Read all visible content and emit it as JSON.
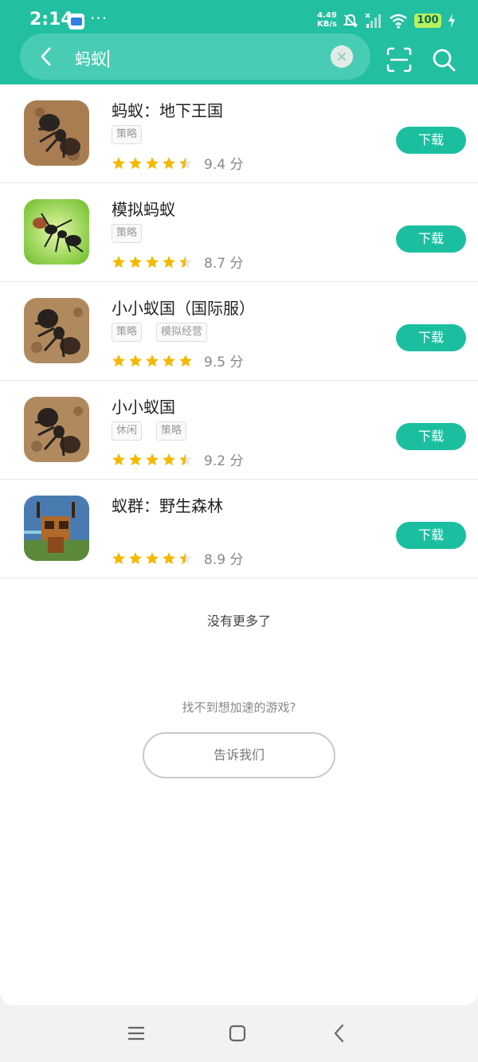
{
  "status_bar": {
    "time": "2:14",
    "more": "···",
    "net_speed_value": "4.49",
    "net_speed_unit": "KB/s",
    "battery": "100"
  },
  "search": {
    "query": "蚂蚁"
  },
  "games": [
    {
      "title": "蚂蚁：地下王国",
      "tags": [
        "策略"
      ],
      "rating": 4.5,
      "score": "9.4 分",
      "download_label": "下载",
      "icon": "ant-underground-kingdom-icon"
    },
    {
      "title": "模拟蚂蚁",
      "tags": [
        "策略"
      ],
      "rating": 4.5,
      "score": "8.7 分",
      "download_label": "下载",
      "icon": "ant-simulator-icon"
    },
    {
      "title": "小小蚁国（国际服）",
      "tags": [
        "策略",
        "模拟经营"
      ],
      "rating": 5,
      "score": "9.5 分",
      "download_label": "下载",
      "icon": "ant-legion-icon"
    },
    {
      "title": "小小蚁国",
      "tags": [
        "休闲",
        "策略"
      ],
      "rating": 4.5,
      "score": "9.2 分",
      "download_label": "下载",
      "icon": "ant-legion-icon"
    },
    {
      "title": "蚁群：野生森林",
      "tags": [],
      "rating": 4.5,
      "score": "8.9 分",
      "download_label": "下载",
      "icon": "pixel-ant-icon"
    }
  ],
  "footer": {
    "no_more": "没有更多了",
    "cant_find": "找不到想加速的游戏?",
    "tell_us": "告诉我们"
  },
  "colors": {
    "accent": "#22bfa0",
    "button": "#1bbfa0",
    "star": "#f5b800"
  }
}
